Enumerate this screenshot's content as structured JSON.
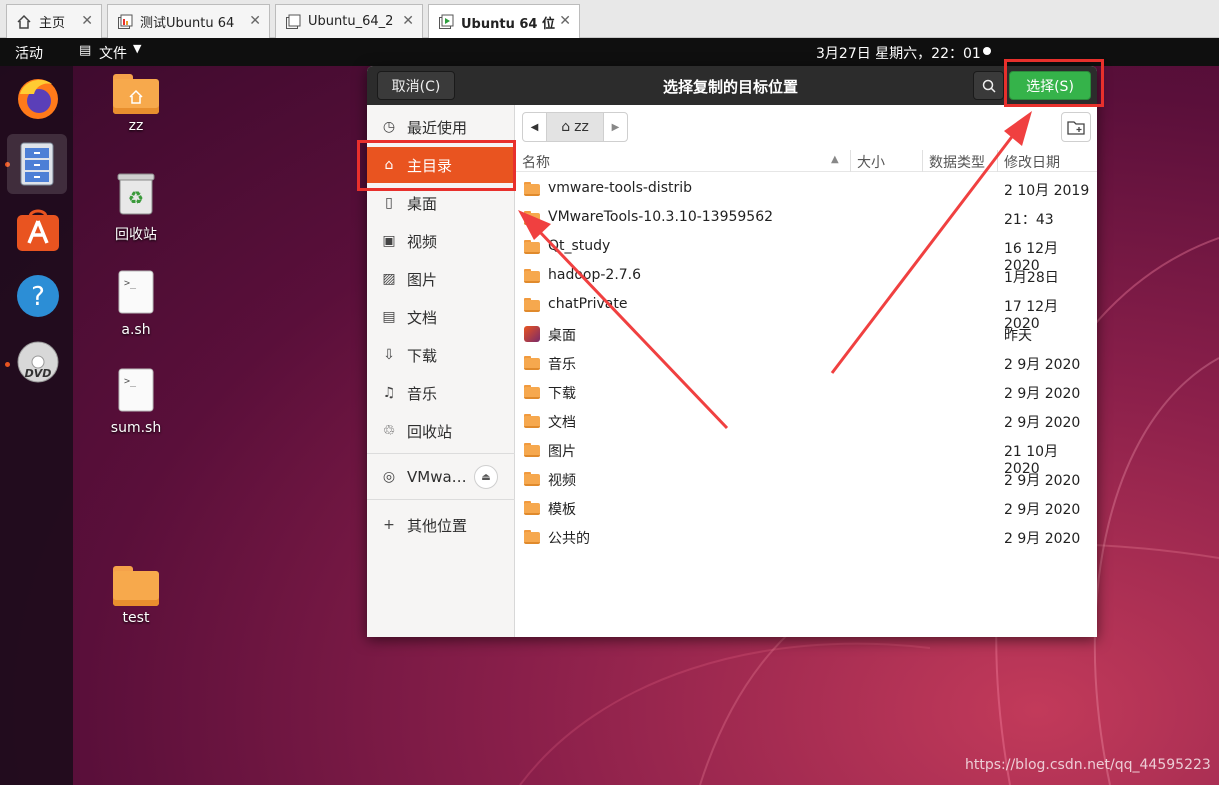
{
  "vmware_tabs": [
    {
      "label": "主页",
      "icon": "home-icon"
    },
    {
      "label": "测试Ubuntu 64",
      "icon": "vm-icon"
    },
    {
      "label": "Ubuntu_64_2",
      "icon": "vm-icon"
    },
    {
      "label": "Ubuntu 64 位",
      "icon": "vm-running-icon"
    }
  ],
  "topbar": {
    "activities": "活动",
    "app_menu": "文件",
    "clock": "3月27日 星期六，22：01"
  },
  "dock": [
    "firefox-icon",
    "files-icon",
    "software-icon",
    "help-icon",
    "dvd-icon"
  ],
  "desktop_icons": [
    {
      "label": "zz"
    },
    {
      "label": "回收站"
    },
    {
      "label": "a.sh"
    },
    {
      "label": "sum.sh"
    },
    {
      "label": "test"
    }
  ],
  "dialog": {
    "title": "选择复制的目标位置",
    "cancel": "取消(C)",
    "select": "选择(S)",
    "path": "zz",
    "sidebar": [
      {
        "label": "最近使用",
        "icon": "recent-icon"
      },
      {
        "label": "主目录",
        "icon": "home-icon"
      },
      {
        "label": "桌面",
        "icon": "desktop-icon"
      },
      {
        "label": "视频",
        "icon": "video-icon"
      },
      {
        "label": "图片",
        "icon": "picture-icon"
      },
      {
        "label": "文档",
        "icon": "document-icon"
      },
      {
        "label": "下载",
        "icon": "download-icon"
      },
      {
        "label": "音乐",
        "icon": "music-icon"
      },
      {
        "label": "回收站",
        "icon": "trash-icon"
      },
      {
        "label": "VMwa…",
        "icon": "disc-icon"
      },
      {
        "label": "其他位置",
        "icon": "plus-icon"
      }
    ],
    "columns": {
      "name": "名称",
      "size": "大小",
      "type": "数据类型",
      "modified": "修改日期"
    },
    "files": [
      {
        "name": "vmware-tools-distrib",
        "date": "2 10月 2019"
      },
      {
        "name": "VMwareTools-10.3.10-13959562",
        "date": "21：43"
      },
      {
        "name": "Qt_study",
        "date": "16 12月 2020"
      },
      {
        "name": "hadoop-2.7.6",
        "date": "1月28日"
      },
      {
        "name": "chatPrivate",
        "date": "17 12月 2020"
      },
      {
        "name": "桌面",
        "date": "昨天"
      },
      {
        "name": "音乐",
        "date": "2 9月 2020"
      },
      {
        "name": "下载",
        "date": "2 9月 2020"
      },
      {
        "name": "文档",
        "date": "2 9月 2020"
      },
      {
        "name": "图片",
        "date": "21 10月 2020"
      },
      {
        "name": "视频",
        "date": "2 9月 2020"
      },
      {
        "name": "模板",
        "date": "2 9月 2020"
      },
      {
        "name": "公共的",
        "date": "2 9月 2020"
      }
    ]
  },
  "watermark": "https://blog.csdn.net/qq_44595223",
  "colors": {
    "accent": "#e95420",
    "select_button": "#35b34a",
    "annotation": "#e8302c"
  }
}
